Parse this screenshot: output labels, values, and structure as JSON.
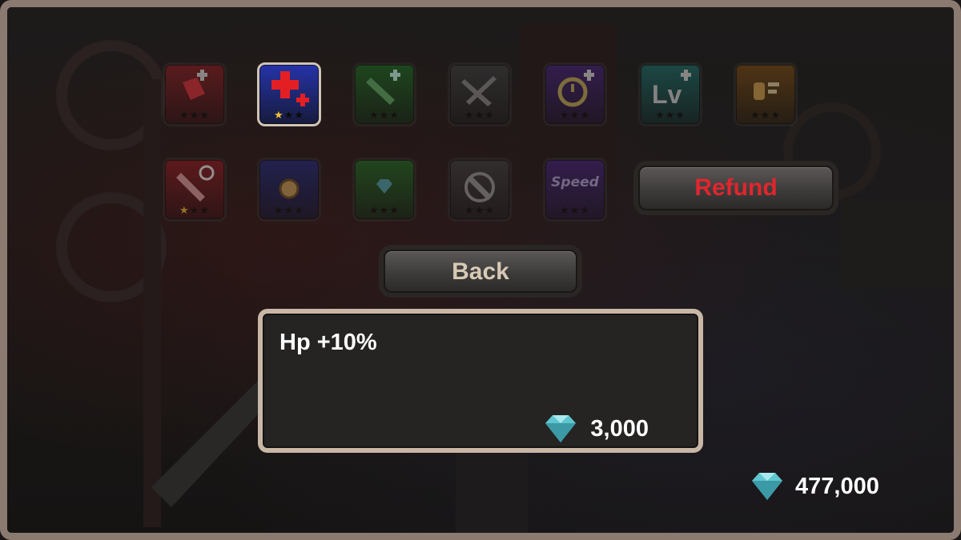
{
  "skills": [
    {
      "name": "attack-power-up",
      "stars": 0,
      "bg": "#8a1c22"
    },
    {
      "name": "hp-up",
      "stars": 1,
      "bg": "#2533a8",
      "selected": true
    },
    {
      "name": "sword-up",
      "stars": 0,
      "bg": "#1d6b23"
    },
    {
      "name": "crit-up",
      "stars": 0,
      "bg": "#3e3e3e"
    },
    {
      "name": "time-up",
      "stars": 0,
      "bg": "#43237a"
    },
    {
      "name": "level-up",
      "stars": 0,
      "bg": "#1d6e69"
    },
    {
      "name": "gold-up",
      "stars": 0,
      "bg": "#7a4a12"
    },
    {
      "name": "attack-speed",
      "stars": 1,
      "bg": "#8a1c22"
    },
    {
      "name": "coin",
      "stars": 0,
      "bg": "#1f2a7c"
    },
    {
      "name": "gem",
      "stars": 0,
      "bg": "#1d6b23"
    },
    {
      "name": "no-sword",
      "stars": 0,
      "bg": "#3e3e3e"
    },
    {
      "name": "speed",
      "stars": 0,
      "bg": "#43237a",
      "label": "Speed"
    }
  ],
  "buttons": {
    "refund_label": "Refund",
    "back_label": "Back"
  },
  "info": {
    "title": "Hp +10%",
    "cost": "3,000"
  },
  "currency": {
    "balance": "477,000",
    "icon": "diamond-icon"
  },
  "colors": {
    "refund_text": "#e0262d",
    "back_text": "#d8c9b4",
    "star_on": "#f2c233",
    "panel_border": "#c9b7a6"
  }
}
